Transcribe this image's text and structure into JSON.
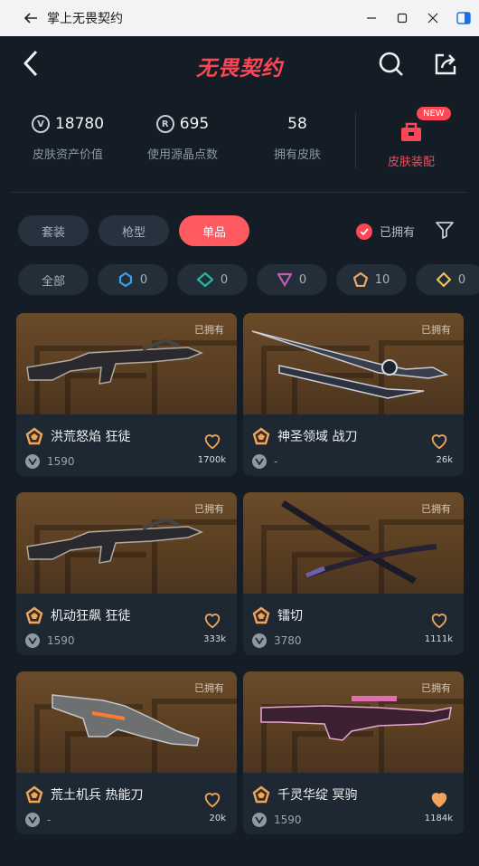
{
  "window": {
    "title": "掌上无畏契约"
  },
  "header": {
    "logo_text": "无畏契约"
  },
  "stats": {
    "asset_value": "18780",
    "asset_value_label": "皮肤资产价值",
    "points_used": "695",
    "points_used_label": "使用源晶点数",
    "owned_count": "58",
    "owned_count_label": "拥有皮肤",
    "assemble_label": "皮肤装配",
    "new_badge": "NEW"
  },
  "tabs": [
    {
      "label": "套装",
      "active": false
    },
    {
      "label": "枪型",
      "active": false
    },
    {
      "label": "单品",
      "active": true
    }
  ],
  "owned_filter": {
    "label": "已拥有",
    "checked": true
  },
  "tiers": [
    {
      "label": "全部"
    },
    {
      "count": "0",
      "color": "#3aa0e8",
      "icon": "select-tier-icon"
    },
    {
      "count": "0",
      "color": "#1fb9a4",
      "icon": "deluxe-tier-icon"
    },
    {
      "count": "0",
      "color": "#c05bb8",
      "icon": "premium-tier-icon"
    },
    {
      "count": "10",
      "color": "#f0a55b",
      "icon": "exclusive-tier-icon"
    },
    {
      "count": "0",
      "color": "#e8c25a",
      "icon": "ultra-tier-icon"
    }
  ],
  "cards": [
    {
      "owned": "已拥有",
      "name": "洪荒怒焰 狂徒",
      "price": "1590",
      "likes": "1700k",
      "liked": false,
      "icon": "rifle-icon"
    },
    {
      "owned": "已拥有",
      "name": "神圣领域 战刀",
      "price": "-",
      "likes": "26k",
      "liked": false,
      "icon": "sword-icon"
    },
    {
      "owned": "已拥有",
      "name": "机动狂飙 狂徒",
      "price": "1590",
      "likes": "333k",
      "liked": false,
      "icon": "rifle-icon"
    },
    {
      "owned": "已拥有",
      "name": "镭切",
      "price": "3780",
      "likes": "1111k",
      "liked": false,
      "icon": "katana-icon"
    },
    {
      "owned": "已拥有",
      "name": "荒土机兵 热能刀",
      "price": "-",
      "likes": "20k",
      "liked": false,
      "icon": "blade-icon"
    },
    {
      "owned": "已拥有",
      "name": "千灵华绽 冥驹",
      "price": "1590",
      "likes": "1184k",
      "liked": true,
      "icon": "sniper-icon"
    }
  ],
  "colors": {
    "accent": "#ff4655",
    "heart": "#f0a55b",
    "tier_exclusive": "#f0a55b"
  }
}
